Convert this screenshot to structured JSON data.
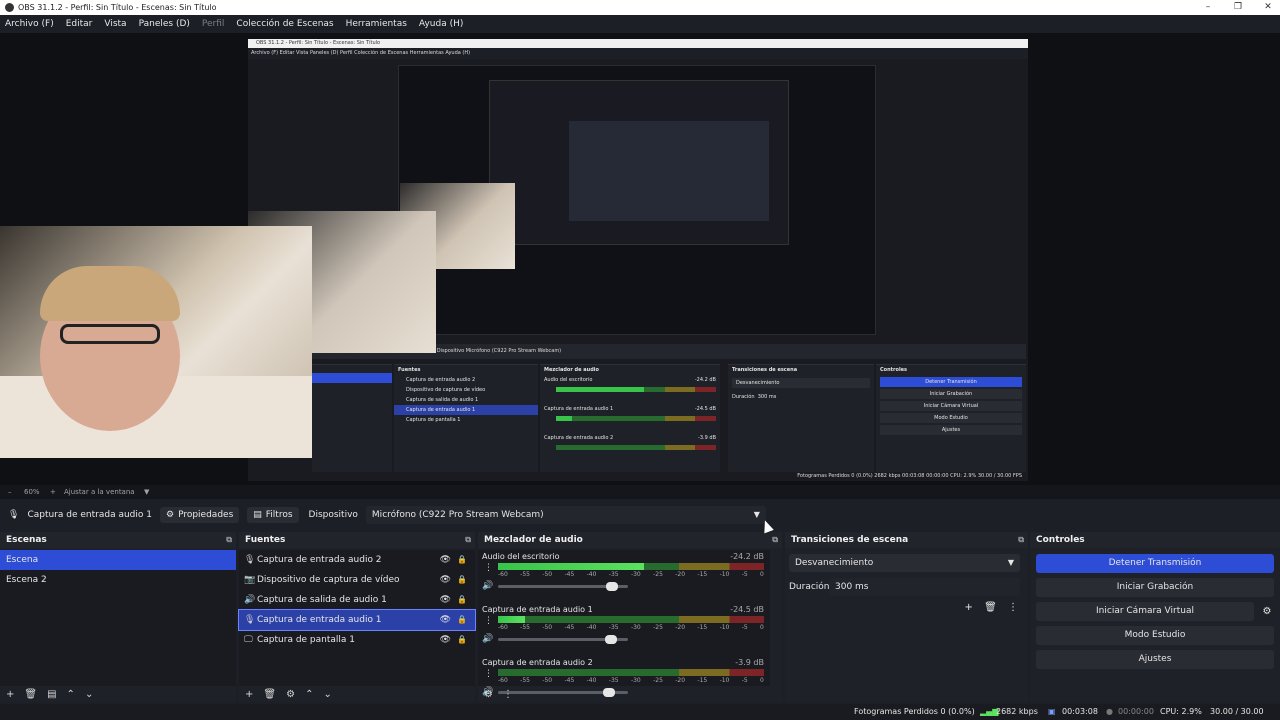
{
  "window": {
    "title": "OBS 31.1.2 - Perfil: Sin Título - Escenas: Sin Título",
    "minimize": "–",
    "maximize": "❐",
    "close": "✕"
  },
  "menu": {
    "items": [
      "Archivo (F)",
      "Editar",
      "Vista",
      "Paneles (D)",
      "Perfil",
      "Colección de Escenas",
      "Herramientas",
      "Ayuda (H)"
    ]
  },
  "nested": {
    "title": "OBS 31.1.2 - Perfil: Sin Título - Escenas: Sin Título",
    "menu": "Archivo (F)   Editar   Vista   Paneles (D)   Perfil   Colección de Escenas   Herramientas   Ayuda (H)",
    "dock_titles": [
      "Fuentes",
      "Mezclador de audio",
      "Transiciones de escena",
      "Controles"
    ],
    "props_text": "Propiedades   Filtros   Dispositivo   Micrófono (C922 Pro Stream Webcam)",
    "sources": [
      "Captura de entrada audio 2",
      "Dispositivo de captura de vídeo",
      "Captura de salida de audio 1",
      "Captura de entrada audio 1",
      "Captura de pantalla 1"
    ],
    "mixer_names": [
      "Audio del escritorio",
      "Captura de entrada audio 1",
      "Captura de entrada audio 2"
    ],
    "mixer_db": [
      "-24.2 dB",
      "-24.5 dB",
      "-3.9 dB"
    ],
    "transition": "Desvanecimiento",
    "duration_label": "Duración",
    "duration": "300 ms",
    "controls": [
      "Detener Transmisión",
      "Iniciar Grabación",
      "Iniciar Cámara Virtual",
      "Modo Estudio",
      "Ajustes"
    ],
    "status": "Fotogramas Perdidos 0 (0.0%)   2682 kbps   00:03:08   00:00:00   CPU: 2.9%   30.00 / 30.00 FPS"
  },
  "zoom": {
    "minus": "–",
    "value": "60%",
    "plus": "+",
    "fit": "Ajustar a la ventana",
    "arrow": "▼"
  },
  "props_bar": {
    "source_name": "Captura de entrada audio 1",
    "properties": "Propiedades",
    "filters": "Filtros",
    "device_label": "Dispositivo",
    "device_value": "Micrófono (C922 Pro Stream Webcam)",
    "arrow": "▼"
  },
  "scenes": {
    "title": "Escenas",
    "items": [
      "Escena",
      "Escena 2"
    ]
  },
  "sources": {
    "title": "Fuentes",
    "items": [
      {
        "label": "Captura de entrada audio 2",
        "icon": "microphone-icon",
        "glyph": "🎙"
      },
      {
        "label": "Dispositivo de captura de vídeo",
        "icon": "camera-icon",
        "glyph": "📷"
      },
      {
        "label": "Captura de salida de audio 1",
        "icon": "speaker-icon",
        "glyph": "🔊"
      },
      {
        "label": "Captura de entrada audio 1",
        "icon": "microphone-icon",
        "glyph": "🎙"
      },
      {
        "label": "Captura de pantalla 1",
        "icon": "monitor-icon",
        "glyph": "🖵"
      }
    ]
  },
  "mixer": {
    "title": "Mezclador de audio",
    "scale": [
      "-60",
      "-55",
      "-50",
      "-45",
      "-40",
      "-35",
      "-30",
      "-25",
      "-20",
      "-15",
      "-10",
      "-5",
      "0"
    ],
    "tracks": [
      {
        "name": "Audio del escritorio",
        "db": "-24.2 dB",
        "level": 0.55,
        "fader": 0.88
      },
      {
        "name": "Captura de entrada audio 1",
        "db": "-24.5 dB",
        "level": 0.1,
        "fader": 0.87
      },
      {
        "name": "Captura de entrada audio 2",
        "db": "-3.9 dB",
        "level": 0.0,
        "fader": 0.85
      }
    ]
  },
  "transitions": {
    "title": "Transiciones de escena",
    "selected": "Desvanecimiento",
    "duration_label": "Duración",
    "duration": "300 ms"
  },
  "controls": {
    "title": "Controles",
    "buttons": [
      "Detener Transmisión",
      "Iniciar Grabación",
      "Iniciar Cámara Virtual",
      "Modo Estudio",
      "Ajustes"
    ]
  },
  "status": {
    "dropped": "Fotogramas Perdidos 0 (0.0%)",
    "bitrate": "2682 kbps",
    "stream_time": "00:03:08",
    "rec_time": "00:00:00",
    "cpu": "CPU: 2.9%",
    "fps": "30.00 / 30.00 FPS"
  },
  "colors": {
    "accent": "#2d4dd6",
    "meter_green": "#38c34a",
    "meter_yellow": "#7c6c22",
    "meter_red": "#7c2426"
  }
}
